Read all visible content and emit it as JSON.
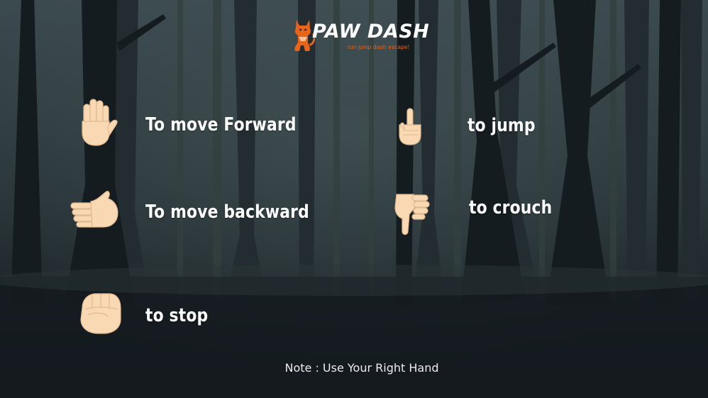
{
  "logo": {
    "title": "PAW DASH",
    "tagline": "run jump dash escape!",
    "icon": "cat-icon",
    "brand_color": "#e8641b"
  },
  "gestures": [
    {
      "icon": "raised-hand-icon",
      "label": "To move Forward"
    },
    {
      "icon": "index-pointing-up-icon",
      "label": "to jump"
    },
    {
      "icon": "hand-pointing-right-icon",
      "label": "To move backward"
    },
    {
      "icon": "thumbs-down-icon",
      "label": "to crouch"
    },
    {
      "icon": "raised-fist-icon",
      "label": "to stop"
    }
  ],
  "note": "Note : Use Your Right Hand",
  "colors": {
    "background": "#1b242a",
    "skin": "#f8d9b4",
    "text": "#ffffff"
  }
}
